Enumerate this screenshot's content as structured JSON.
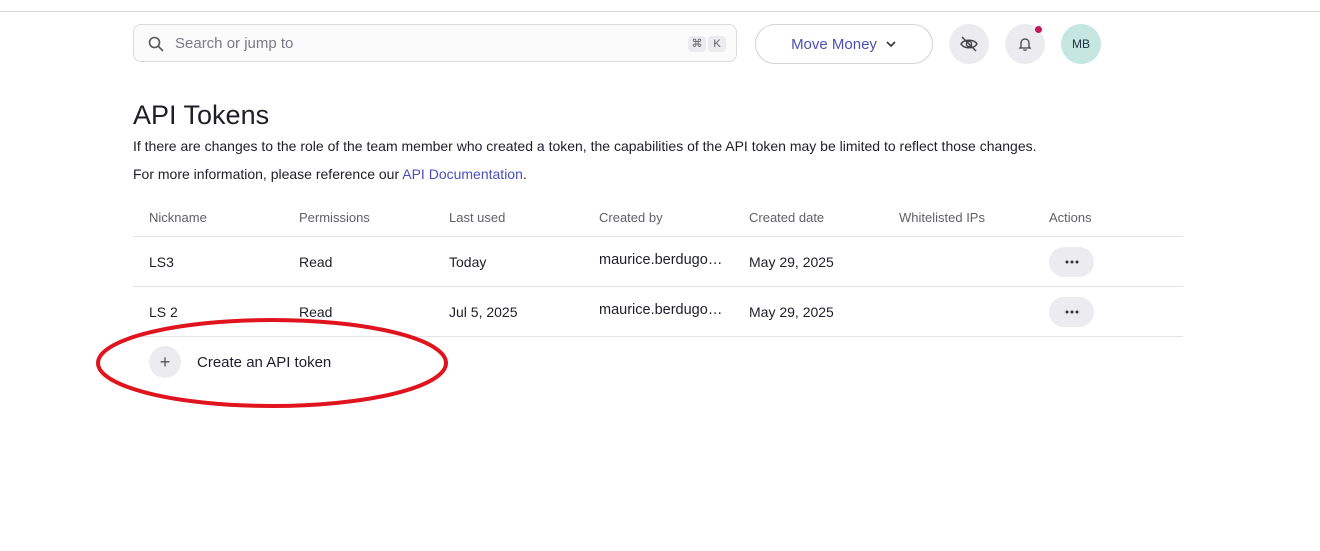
{
  "search": {
    "placeholder": "Search or jump to",
    "shortcut_keys": [
      "⌘",
      "K"
    ],
    "icon": "search-icon"
  },
  "header": {
    "move_money_label": "Move Money",
    "hide_balances_icon": "eye-slash-icon",
    "notifications_icon": "bell-icon",
    "has_notification": true,
    "notification_color": "#c2185b",
    "avatar_initials": "MB"
  },
  "page": {
    "title": "API Tokens",
    "description": "If there are changes to the role of the team member who created a token, the capabilities of the API token may be limited to reflect those changes.",
    "info_prefix": "For more information, please reference our ",
    "info_link": "API Documentation",
    "info_suffix": "."
  },
  "table": {
    "columns": [
      "Nickname",
      "Permissions",
      "Last used",
      "Created by",
      "Created date",
      "Whitelisted IPs",
      "Actions"
    ],
    "rows": [
      {
        "nickname": "LS3",
        "permissions": "Read",
        "last_used": "Today",
        "created_by": "maurice.berdugo…",
        "created_date": "May 29, 2025",
        "whitelisted_ips": "",
        "actions_icon": "more-horizontal-icon"
      },
      {
        "nickname": "LS 2",
        "permissions": "Read",
        "last_used": "Jul 5, 2025",
        "created_by": "maurice.berdugo…",
        "created_date": "May 29, 2025",
        "whitelisted_ips": "",
        "actions_icon": "more-horizontal-icon"
      }
    ]
  },
  "create": {
    "label": "Create an API token",
    "icon": "plus-icon"
  },
  "colors": {
    "accent": "#4b4fb8",
    "annotation": "#e0141e"
  }
}
